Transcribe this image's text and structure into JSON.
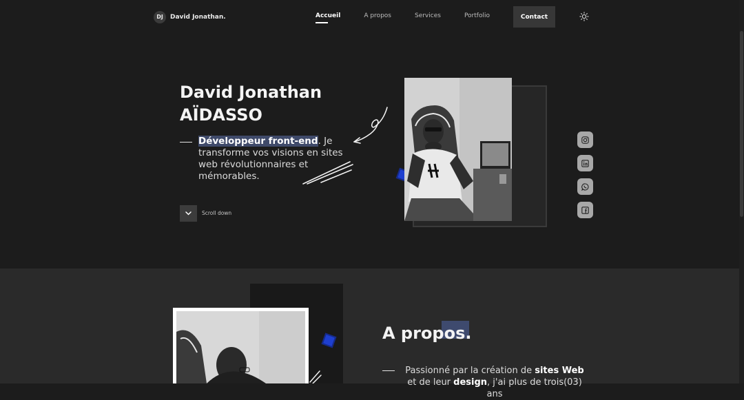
{
  "header": {
    "logo_initials": "DJ",
    "logo_name": "David Jonathan.",
    "nav": [
      {
        "label": "Accueil",
        "active": true
      },
      {
        "label": "A propos",
        "active": false
      },
      {
        "label": "Services",
        "active": false
      },
      {
        "label": "Portfolio",
        "active": false
      }
    ],
    "contact_label": "Contact",
    "theme_icon": "sun-icon"
  },
  "hero": {
    "title_line1": "David Jonathan",
    "title_line2": "AÏDASSO",
    "role": "Développeur front-end",
    "tagline": ". Je transforme vos visions en sites web révolutionnaires et mémorables.",
    "scroll_label": "Scroll down",
    "scroll_icon": "chevron-down-icon"
  },
  "socials": [
    {
      "name": "instagram-icon"
    },
    {
      "name": "linkedin-icon"
    },
    {
      "name": "whatsapp-icon"
    },
    {
      "name": "facebook-icon"
    }
  ],
  "about": {
    "title": "A propos.",
    "text_before": "Passionné par la création de ",
    "bold1": "sites Web",
    "text_mid": " et de leur ",
    "bold2": "design",
    "text_after": ", j'ai plus de trois(03) ans"
  },
  "colors": {
    "background": "#1c1c1c",
    "section_alt": "#2a2a2a",
    "accent_blue": "#1e3fd0",
    "highlight": "#3f4a6a"
  }
}
